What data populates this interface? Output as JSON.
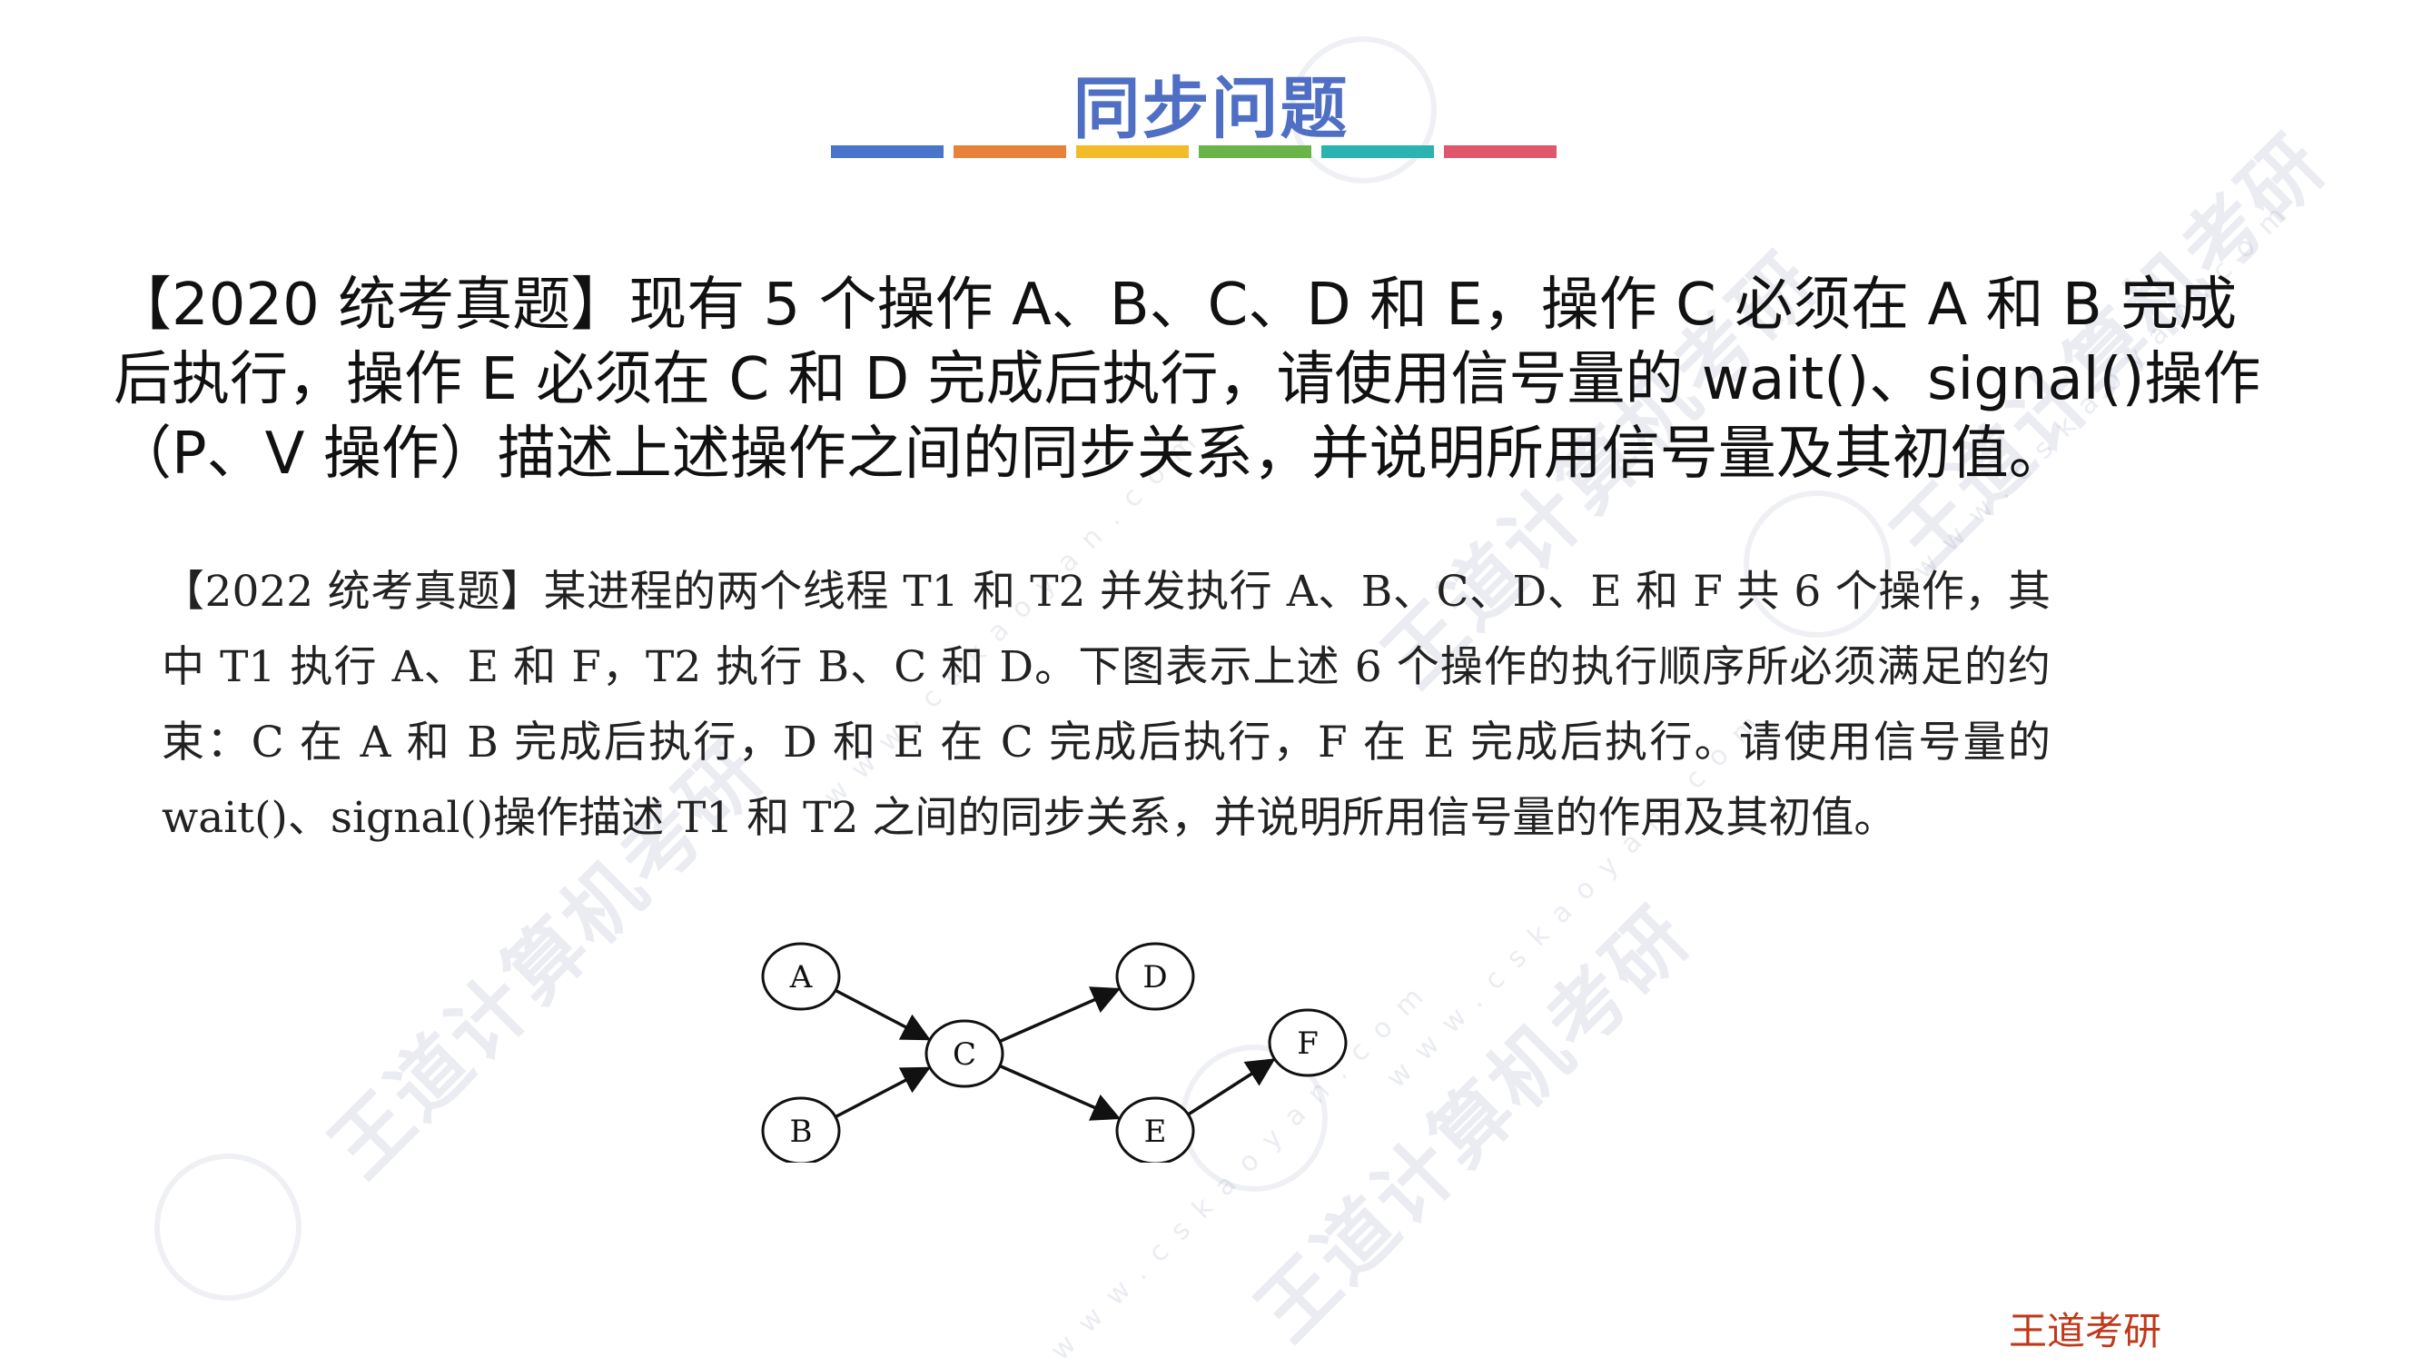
{
  "slide": {
    "title": "同步问题",
    "title_bar_colors": [
      "#4a74c9",
      "#e8823a",
      "#f2bb2a",
      "#6ab44a",
      "#2bb3b1",
      "#e0566a"
    ],
    "question_2020": "【2020 统考真题】现有 5 个操作 A、B、C、D 和 E，操作 C 必须在 A 和 B 完成后执行，操作 E 必须在 C 和 D 完成后执行，请使用信号量的 wait()、signal()操作（P、V 操作）描述上述操作之间的同步关系，并说明所用信号量及其初值。",
    "question_2022": "【2022 统考真题】某进程的两个线程 T1 和 T2 并发执行 A、B、C、D、E 和 F 共 6 个操作，其中 T1 执行 A、E 和 F，T2 执行 B、C 和 D。下图表示上述 6 个操作的执行顺序所必须满足的约束：C 在 A 和 B 完成后执行，D 和 E 在 C 完成后执行，F 在 E 完成后执行。请使用信号量的 wait()、signal()操作描述 T1 和 T2 之间的同步关系，并说明所用信号量的作用及其初值。",
    "footer_brand": "王道考研"
  },
  "graph": {
    "nodes": [
      {
        "id": "A",
        "label": "A"
      },
      {
        "id": "B",
        "label": "B"
      },
      {
        "id": "C",
        "label": "C"
      },
      {
        "id": "D",
        "label": "D"
      },
      {
        "id": "E",
        "label": "E"
      },
      {
        "id": "F",
        "label": "F"
      }
    ],
    "edges": [
      {
        "from": "A",
        "to": "C"
      },
      {
        "from": "B",
        "to": "C"
      },
      {
        "from": "C",
        "to": "D"
      },
      {
        "from": "C",
        "to": "E"
      },
      {
        "from": "E",
        "to": "F"
      }
    ]
  },
  "watermark": {
    "brand": "王道计算机考研",
    "url": "www.cskaoyan.com"
  }
}
